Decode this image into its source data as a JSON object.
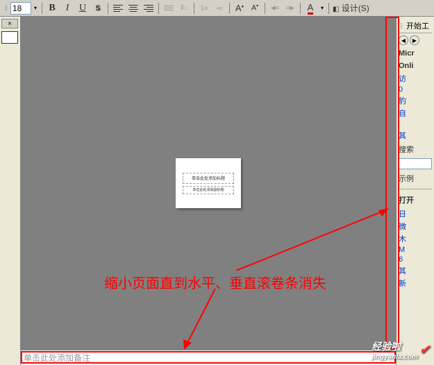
{
  "toolbar": {
    "font_size": "18",
    "bold": "B",
    "italic": "I",
    "underline": "U",
    "shadow": "S",
    "align_left": "≡",
    "font_increase": "A",
    "font_decrease": "A",
    "font_color": "A",
    "design_menu": "设计(S)"
  },
  "thumbnail": {
    "close": "×"
  },
  "slide": {
    "title_placeholder": "单击此处添加标题",
    "subtitle_placeholder": "单击此处添加副标题"
  },
  "notes": {
    "placeholder": "单击此处添加备注"
  },
  "sidepanel": {
    "title": "开始工",
    "heading1": "Micr",
    "heading2": "Onli",
    "link1": "访",
    "link2": "0",
    "link3": "豹",
    "link4": "自",
    "link5": "其",
    "search_label": "搜索",
    "example_label": "示例",
    "open_label": "打开",
    "link6": "日",
    "link7": "微",
    "link8": "木",
    "link9": "M",
    "link10": "6",
    "link11": "其",
    "link12": "新"
  },
  "annotation": {
    "text": "缩小页面直到水平、垂直滚卷条消失"
  },
  "watermark": {
    "text": "经验啦",
    "url": "jingyanla.com"
  }
}
